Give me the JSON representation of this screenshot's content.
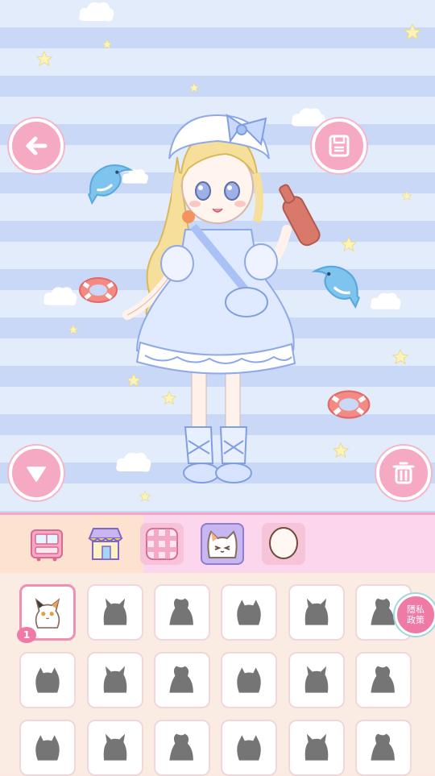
{
  "scene": {
    "colors": {
      "stripe_light": "#e3ecfb",
      "stripe_dark": "#c9d8f6",
      "accent_pink": "#f5a9c3"
    }
  },
  "controls": {
    "back_icon": "arrow-left-icon",
    "save_icon": "floppy-disk-icon",
    "down_icon": "triangle-down-icon",
    "delete_icon": "trash-icon"
  },
  "tabs": [
    {
      "icon": "wardrobe-icon"
    },
    {
      "icon": "shop-icon"
    },
    {
      "icon": "gingham-pattern-icon"
    },
    {
      "icon": "cat-face-icon",
      "selected": true
    },
    {
      "icon": "face-outline-icon"
    }
  ],
  "items": {
    "owned_count": "1",
    "rows": 3,
    "cols": 6
  },
  "privacy": {
    "line1": "隱私",
    "line2": "政策"
  }
}
